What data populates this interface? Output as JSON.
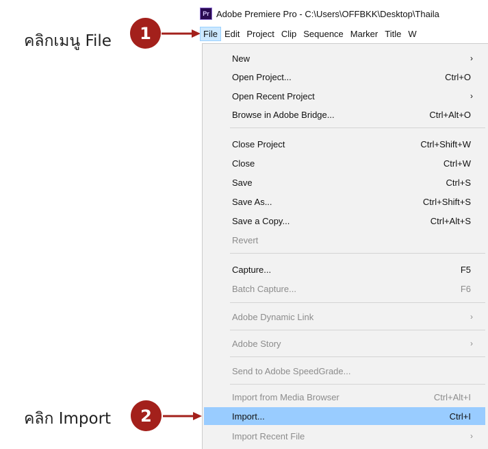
{
  "window": {
    "title": "Adobe Premiere Pro - C:\\Users\\OFFBKK\\Desktop\\Thaila",
    "app_icon_text": "Pr"
  },
  "menubar": {
    "items": [
      "File",
      "Edit",
      "Project",
      "Clip",
      "Sequence",
      "Marker",
      "Title",
      "W"
    ]
  },
  "annotations": {
    "step1_label": "คลิกเมนู File",
    "step1_number": "1",
    "step2_label": "คลิก Import",
    "step2_number": "2",
    "accent_color": "#a3201b"
  },
  "file_menu": {
    "new": {
      "label": "New",
      "shortcut": ""
    },
    "open_project": {
      "label": "Open Project...",
      "shortcut": "Ctrl+O"
    },
    "open_recent": {
      "label": "Open Recent Project",
      "shortcut": ""
    },
    "browse_bridge": {
      "label": "Browse in Adobe Bridge...",
      "shortcut": "Ctrl+Alt+O"
    },
    "close_project": {
      "label": "Close Project",
      "shortcut": "Ctrl+Shift+W"
    },
    "close": {
      "label": "Close",
      "shortcut": "Ctrl+W"
    },
    "save": {
      "label": "Save",
      "shortcut": "Ctrl+S"
    },
    "save_as": {
      "label": "Save As...",
      "shortcut": "Ctrl+Shift+S"
    },
    "save_copy": {
      "label": "Save a Copy...",
      "shortcut": "Ctrl+Alt+S"
    },
    "revert": {
      "label": "Revert",
      "shortcut": ""
    },
    "capture": {
      "label": "Capture...",
      "shortcut": "F5"
    },
    "batch_capture": {
      "label": "Batch Capture...",
      "shortcut": "F6"
    },
    "dynamic_link": {
      "label": "Adobe Dynamic Link",
      "shortcut": ""
    },
    "adobe_story": {
      "label": "Adobe Story",
      "shortcut": ""
    },
    "speedgrade": {
      "label": "Send to Adobe SpeedGrade...",
      "shortcut": ""
    },
    "import_media_browser": {
      "label": "Import from Media Browser",
      "shortcut": "Ctrl+Alt+I"
    },
    "import": {
      "label": "Import...",
      "shortcut": "Ctrl+I"
    },
    "import_recent": {
      "label": "Import Recent File",
      "shortcut": ""
    },
    "submenu_glyph": "›",
    "highlight_color": "#99ccff"
  }
}
